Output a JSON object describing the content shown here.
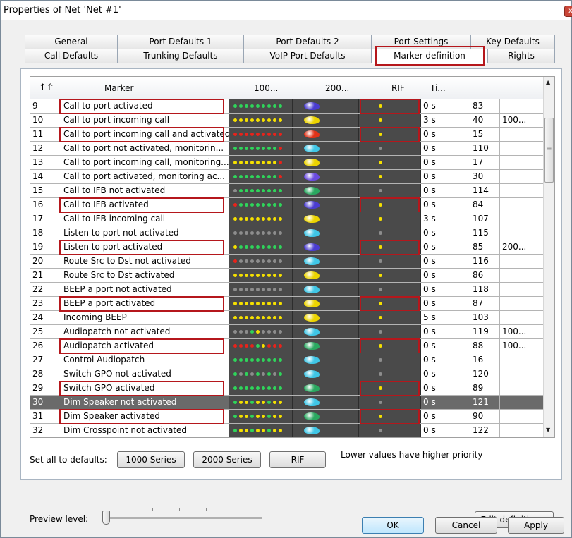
{
  "window": {
    "title": "Properties of Net 'Net #1'",
    "close_glyph": "x"
  },
  "tabs_row1": [
    "General",
    "Port Defaults 1",
    "Port Defaults 2",
    "Port Settings",
    "Key Defaults"
  ],
  "tabs_row2": [
    "Call Defaults",
    "Trunking Defaults",
    "VoIP Port Defaults",
    "Marker definition",
    "Rights"
  ],
  "active_tab": "Marker definition",
  "table": {
    "columns": [
      "Marker",
      "100...",
      "200...",
      "RIF",
      "Ti...",
      "",
      ""
    ],
    "sort_indicator": "↑⇧",
    "rows": [
      {
        "id": "9",
        "name": "Call to port activated",
        "leds": "ggggggggg",
        "blob": "#4a3cd0",
        "rif": "y",
        "time": "0 s",
        "prio": "83",
        "extra": "",
        "hl": true,
        "sel": false
      },
      {
        "id": "10",
        "name": "Call to port incoming call",
        "leds": "yyyyyyyyy",
        "blob": "#ecd400",
        "rif": "y",
        "time": "3 s",
        "prio": "40",
        "extra": "100...",
        "hl": false,
        "sel": false
      },
      {
        "id": "11",
        "name": "Call to port incoming call and activated",
        "leds": "rrrrrrrrr",
        "blob": "#e03218",
        "rif": "y",
        "time": "0 s",
        "prio": "15",
        "extra": "",
        "hl": true,
        "sel": false
      },
      {
        "id": "12",
        "name": "Call to port not activated, monitorin...",
        "leds": "ggggggggr",
        "blob": "#3fc6e6",
        "rif": "n",
        "time": "0 s",
        "prio": "110",
        "extra": "",
        "hl": false,
        "sel": false
      },
      {
        "id": "13",
        "name": "Call to port incoming call, monitoring...",
        "leds": "yyyyyyyyr",
        "blob": "#ecd400",
        "rif": "y",
        "time": "0 s",
        "prio": "17",
        "extra": "",
        "hl": false,
        "sel": false
      },
      {
        "id": "14",
        "name": "Call to port activated, monitoring ac...",
        "leds": "ggggggggr",
        "blob": "#6a4ae0",
        "rif": "y",
        "time": "0 s",
        "prio": "30",
        "extra": "",
        "hl": false,
        "sel": false
      },
      {
        "id": "15",
        "name": "Call to IFB not activated",
        "leds": "ngggggggg",
        "blob": "#2aa860",
        "rif": "n",
        "time": "0 s",
        "prio": "114",
        "extra": "",
        "hl": false,
        "sel": false
      },
      {
        "id": "16",
        "name": "Call to IFB activated",
        "leds": "rgggggggg",
        "blob": "#4a3cd0",
        "rif": "y",
        "time": "0 s",
        "prio": "84",
        "extra": "",
        "hl": true,
        "sel": false
      },
      {
        "id": "17",
        "name": "Call to IFB incoming call",
        "leds": "yyyyyyyyy",
        "blob": "#ecd400",
        "rif": "y",
        "time": "3 s",
        "prio": "107",
        "extra": "",
        "hl": false,
        "sel": false
      },
      {
        "id": "18",
        "name": "Listen to port not activated",
        "leds": "nnnnnnnnn",
        "blob": "#3fc6e6",
        "rif": "n",
        "time": "0 s",
        "prio": "115",
        "extra": "",
        "hl": false,
        "sel": false
      },
      {
        "id": "19",
        "name": "Listen to port activated",
        "leds": "ygggggggg",
        "blob": "#4a3cd0",
        "rif": "y",
        "time": "0 s",
        "prio": "85",
        "extra": "200...",
        "hl": true,
        "sel": false
      },
      {
        "id": "20",
        "name": "Route Src to Dst not activated",
        "leds": "rnnnnnnnn",
        "blob": "#3fc6e6",
        "rif": "n",
        "time": "0 s",
        "prio": "116",
        "extra": "",
        "hl": false,
        "sel": false
      },
      {
        "id": "21",
        "name": "Route Src to Dst activated",
        "leds": "yyyyyyyyy",
        "blob": "#ecd400",
        "rif": "y",
        "time": "0 s",
        "prio": "86",
        "extra": "",
        "hl": false,
        "sel": false
      },
      {
        "id": "22",
        "name": "BEEP a port not activated",
        "leds": "nnnnnnnnn",
        "blob": "#3fc6e6",
        "rif": "n",
        "time": "0 s",
        "prio": "118",
        "extra": "",
        "hl": false,
        "sel": false
      },
      {
        "id": "23",
        "name": "BEEP a port activated",
        "leds": "yyyyyyyyy",
        "blob": "#ecd400",
        "rif": "y",
        "time": "0 s",
        "prio": "87",
        "extra": "",
        "hl": true,
        "sel": false
      },
      {
        "id": "24",
        "name": "Incoming BEEP",
        "leds": "yyyyyyyyy",
        "blob": "#ecd400",
        "rif": "y",
        "time": "5 s",
        "prio": "103",
        "extra": "",
        "hl": false,
        "sel": false
      },
      {
        "id": "25",
        "name": "Audiopatch not activated",
        "leds": "nnngynnnn",
        "blob": "#3fc6e6",
        "rif": "n",
        "time": "0 s",
        "prio": "119",
        "extra": "100...",
        "hl": false,
        "sel": false
      },
      {
        "id": "26",
        "name": "Audiopatch activated",
        "leds": "rrrrgyrrr",
        "blob": "#2aa860",
        "rif": "y",
        "time": "0 s",
        "prio": "88",
        "extra": "100...",
        "hl": true,
        "sel": false
      },
      {
        "id": "27",
        "name": "Control Audiopatch",
        "leds": "ggggggggg",
        "blob": "#3fc6e6",
        "rif": "n",
        "time": "0 s",
        "prio": "16",
        "extra": "",
        "hl": false,
        "sel": false
      },
      {
        "id": "28",
        "name": "Switch GPO not activated",
        "leds": "gngngngng",
        "blob": "#3fc6e6",
        "rif": "n",
        "time": "0 s",
        "prio": "120",
        "extra": "",
        "hl": false,
        "sel": false
      },
      {
        "id": "29",
        "name": "Switch GPO  activated",
        "leds": "ggggggggg",
        "blob": "#2aa860",
        "rif": "y",
        "time": "0 s",
        "prio": "89",
        "extra": "",
        "hl": true,
        "sel": false
      },
      {
        "id": "30",
        "name": "Dim Speaker not activated",
        "leds": "gyygyygyy",
        "blob": "#3fc6e6",
        "rif": "n",
        "time": "0 s",
        "prio": "121",
        "extra": "",
        "hl": false,
        "sel": true
      },
      {
        "id": "31",
        "name": "Dim Speaker activated",
        "leds": "gyygyygyy",
        "blob": "#2aa860",
        "rif": "y",
        "time": "0 s",
        "prio": "90",
        "extra": "",
        "hl": true,
        "sel": false
      },
      {
        "id": "32",
        "name": "Dim Crosspoint not activated",
        "leds": "gyygyygyy",
        "blob": "#3fc6e6",
        "rif": "n",
        "time": "0 s",
        "prio": "122",
        "extra": "",
        "hl": false,
        "sel": false
      }
    ]
  },
  "footer": {
    "set_defaults_label": "Set all to defaults:",
    "btn_1000": "1000 Series",
    "btn_2000": "2000 Series",
    "btn_rif": "RIF",
    "priority_note": "Lower values have higher priority",
    "preview_label": "Preview level:",
    "edit_button": "Edit definition...",
    "preview_level": 0
  },
  "dialog_buttons": {
    "ok": "OK",
    "cancel": "Cancel",
    "apply": "Apply"
  },
  "colors": {
    "highlight": "#b5171c",
    "selected_row": "#6a6a6a",
    "led_green": "#2fd45a",
    "led_yellow": "#f5e000",
    "led_red": "#e8231b",
    "led_off": "#8d8d8d"
  }
}
